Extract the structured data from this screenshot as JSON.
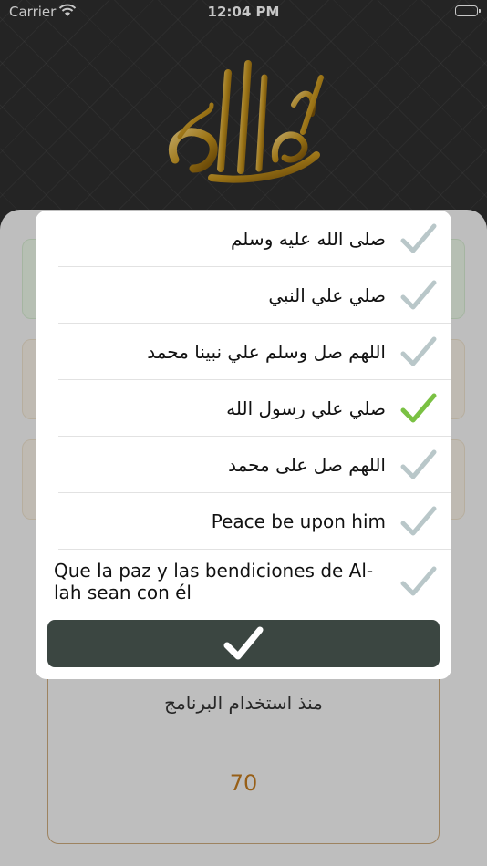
{
  "status_bar": {
    "carrier": "Carrier",
    "time": "12:04 PM"
  },
  "header": {
    "logo_icon": "calligraphy-rasul-allah-icon",
    "logo_color": "#c8961e"
  },
  "counter": {
    "label": "منذ استخدام البرنامج",
    "value": "70",
    "value_color": "#c27a1e"
  },
  "modal": {
    "options": [
      {
        "label": "صلى الله عليه وسلم",
        "selected": false
      },
      {
        "label": "صلي علي النبي",
        "selected": false
      },
      {
        "label": "اللهم صل وسلم علي نبينا محمد",
        "selected": false
      },
      {
        "label": "صلي علي رسول الله",
        "selected": true
      },
      {
        "label": "اللهم صل على محمد",
        "selected": false
      },
      {
        "label": "Peace be upon him",
        "selected": false
      },
      {
        "label": "Que la paz y las bendiciones de Al-lah sean con él",
        "selected": false
      }
    ],
    "confirm_icon": "checkmark-icon",
    "check_colors": {
      "selected": "#7ac143",
      "unselected": "#b9c7c9"
    },
    "confirm_color": "#3b4641"
  }
}
